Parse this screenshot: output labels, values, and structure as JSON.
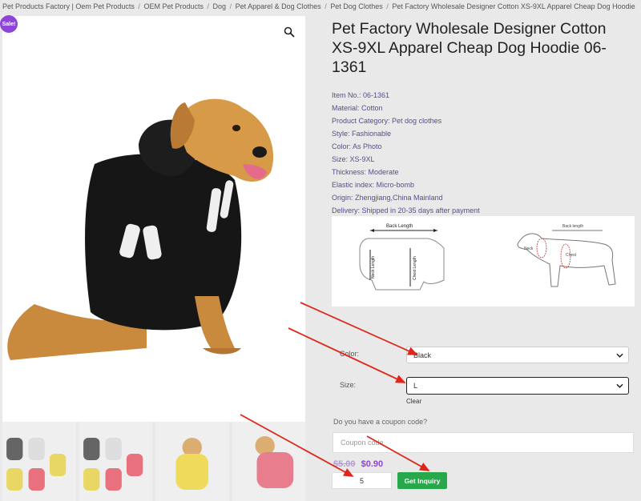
{
  "breadcrumb": [
    "Pet Products Factory | Oem Pet Products",
    "OEM Pet Products",
    "Dog",
    "Pet Apparel & Dog Clothes",
    "Pet Dog Clothes",
    "Pet Factory Wholesale Designer Cotton XS-9XL Apparel Cheap Dog Hoodie 06-1361"
  ],
  "breadcrumb_sep": "/",
  "gallery": {
    "sale_badge": "Sale!"
  },
  "product": {
    "title": "Pet Factory Wholesale Designer Cotton XS-9XL Apparel Cheap Dog Hoodie 06-1361",
    "specs": [
      "Item No.: 06-1361",
      "Material: Cotton",
      "Product Category: Pet dog clothes",
      "Style: Fashionable",
      "Color: As Photo",
      "Size: XS-9XL",
      "Thickness: Moderate",
      "Elastic index: Micro-bomb",
      "Origin: Zhengjiang,China Mainland",
      "Delivery: Shipped in 20-35 days after payment"
    ]
  },
  "size_chart": {
    "left_labels": [
      "Back Length",
      "Neck Length",
      "Chest Length"
    ],
    "right_labels": [
      "Back length",
      "Neck",
      "Chest"
    ]
  },
  "options": {
    "color_label": "Color:",
    "color_value": "Black",
    "size_label": "Size:",
    "size_value": "L",
    "clear": "Clear"
  },
  "coupon": {
    "question": "Do you have a coupon code?",
    "placeholder": "Coupon code"
  },
  "price": {
    "old": "$5.00",
    "new": "$0.90"
  },
  "cart": {
    "quantity": "5",
    "button": "Get Inquiry"
  },
  "colors": {
    "accent": "#8e44d8",
    "button": "#27a84a",
    "annotation_arrow": "#e0261b"
  }
}
